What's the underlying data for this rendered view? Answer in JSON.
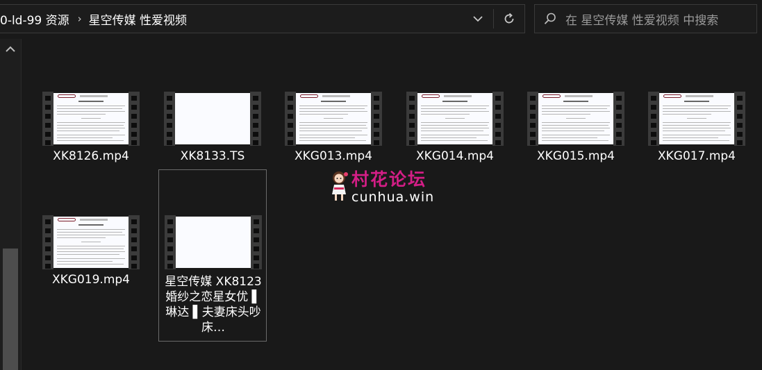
{
  "breadcrumb": {
    "items": [
      "0-ld-99 资源",
      "星空传媒 性爱视频"
    ],
    "separator": "›"
  },
  "search": {
    "placeholder": "在 星空传媒 性爱视频 中搜索"
  },
  "files": [
    {
      "name": "XK8126.mp4",
      "thumbnail": "document"
    },
    {
      "name": "XK8133.TS",
      "thumbnail": "blank"
    },
    {
      "name": "XKG013.mp4",
      "thumbnail": "document"
    },
    {
      "name": "XKG014.mp4",
      "thumbnail": "document"
    },
    {
      "name": "XKG015.mp4",
      "thumbnail": "document"
    },
    {
      "name": "XKG017.mp4",
      "thumbnail": "document"
    },
    {
      "name": "XKG019.mp4",
      "thumbnail": "document"
    },
    {
      "name": "星空传媒 XK8123 婚纱之恋星女优 ▌琳达 ▌夫妻床头吵床…",
      "thumbnail": "blank",
      "selected": true
    }
  ],
  "watermark": {
    "title": "村花论坛",
    "url": "cunhua.win"
  },
  "colors": {
    "background": "#191919",
    "border": "#3a3a3a",
    "watermark_title": "#d31e86",
    "selection_border": "#6b6b6b"
  }
}
